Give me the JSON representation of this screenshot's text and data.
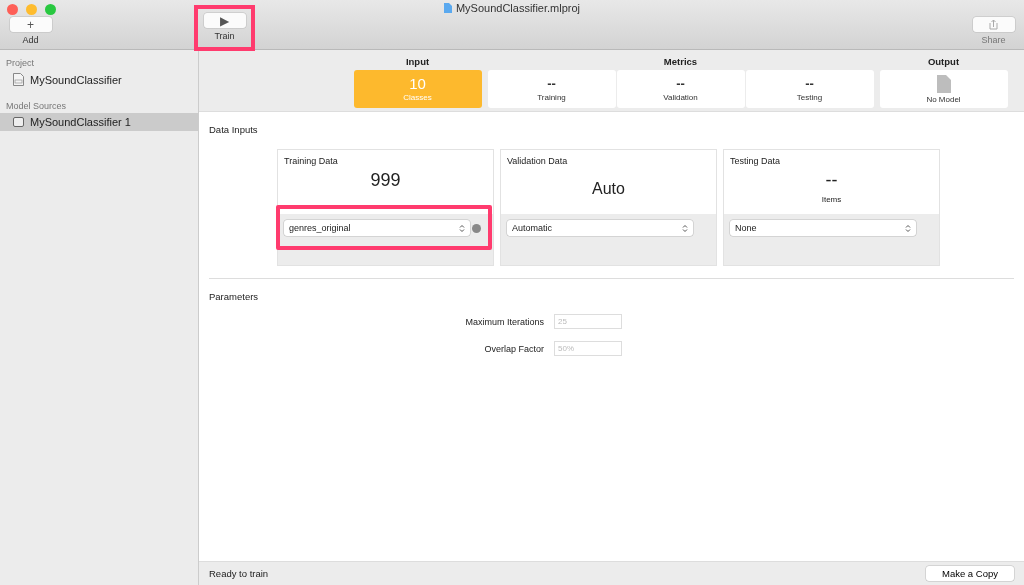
{
  "window": {
    "title": "MySoundClassifier.mlproj"
  },
  "toolbar": [
    {
      "kind": "add",
      "label": "Add",
      "icon": "+",
      "highlighted": false,
      "disabled": false
    },
    {
      "kind": "train",
      "label": "Train",
      "icon": "▶",
      "highlighted": true,
      "disabled": false
    },
    {
      "kind": "share",
      "label": "Share",
      "highlighted": false,
      "disabled": true
    }
  ],
  "sidebar": {
    "sections": [
      {
        "title": "Project",
        "items": [
          {
            "label": "MySoundClassifier",
            "kind": "project",
            "selected": false
          }
        ]
      },
      {
        "title": "Model Sources",
        "items": [
          {
            "label": "MySoundClassifier 1",
            "kind": "model",
            "selected": true
          }
        ]
      }
    ]
  },
  "summary": {
    "groups": [
      {
        "title": "Input",
        "cards": [
          {
            "value": "10",
            "label": "Classes",
            "kind": "active"
          }
        ]
      },
      {
        "title": "Metrics",
        "cards": [
          {
            "value": "--",
            "label": "Training",
            "kind": "plain"
          },
          {
            "value": "--",
            "label": "Validation",
            "kind": "plain"
          },
          {
            "value": "--",
            "label": "Testing",
            "kind": "plain"
          }
        ]
      },
      {
        "title": "Output",
        "cards": [
          {
            "label": "No Model",
            "kind": "file"
          }
        ]
      }
    ]
  },
  "data_inputs": {
    "title": "Data Inputs",
    "cards": [
      {
        "title": "Training Data",
        "value": "999",
        "dropdown": "genres_original",
        "highlighted": true,
        "kind": "count"
      },
      {
        "title": "Validation Data",
        "value": "Auto",
        "dropdown": "Automatic",
        "highlighted": false,
        "kind": "mode"
      },
      {
        "title": "Testing Data",
        "value": "--",
        "caption": "Items",
        "dropdown": "None",
        "highlighted": false,
        "kind": "count"
      }
    ]
  },
  "parameters": {
    "title": "Parameters",
    "fields": [
      {
        "label": "Maximum Iterations",
        "placeholder": "25"
      },
      {
        "label": "Overlap Factor",
        "placeholder": "50%"
      }
    ]
  },
  "status_bar": {
    "text": "Ready to train",
    "button": "Make a Copy"
  }
}
